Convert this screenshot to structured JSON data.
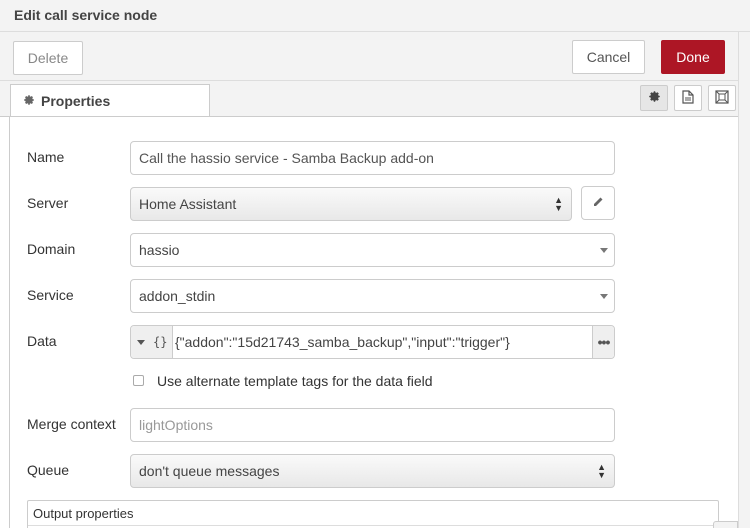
{
  "dialog": {
    "title": "Edit call service node"
  },
  "toolbar": {
    "delete_label": "Delete",
    "cancel_label": "Cancel",
    "done_label": "Done",
    "done_color": "#ad1625"
  },
  "tabs": {
    "properties_label": "Properties",
    "icons": [
      "gear-icon",
      "description-icon",
      "appearance-icon"
    ]
  },
  "form": {
    "name": {
      "label": "Name",
      "value": "Call the hassio service - Samba Backup add-on"
    },
    "server": {
      "label": "Server",
      "value": "Home Assistant",
      "edit_icon": "pencil-icon"
    },
    "domain": {
      "label": "Domain",
      "value": "hassio"
    },
    "service": {
      "label": "Service",
      "value": "addon_stdin"
    },
    "data": {
      "label": "Data",
      "type_icon": "{}",
      "value": "{\"addon\":\"15d21743_samba_backup\",\"input\":\"trigger\"}",
      "expand_label": "•••"
    },
    "alt_template": {
      "label": "Use alternate template tags for the data field",
      "checked": false
    },
    "merge_context": {
      "label": "Merge context",
      "placeholder": "lightOptions",
      "value": ""
    },
    "queue": {
      "label": "Queue",
      "value": "don't queue messages"
    },
    "output_properties": {
      "label": "Output properties"
    }
  }
}
